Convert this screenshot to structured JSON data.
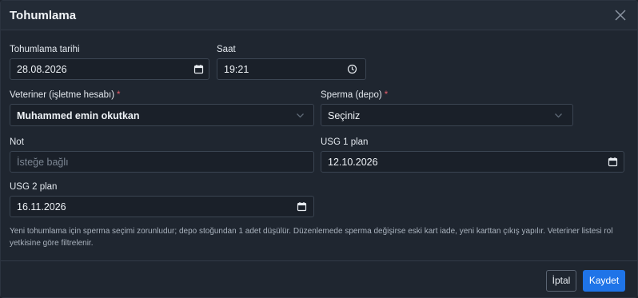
{
  "modal": {
    "title": "Tohumlama"
  },
  "form": {
    "insemination_date": {
      "label": "Tohumlama tarihi",
      "value": "28.08.2026"
    },
    "time": {
      "label": "Saat",
      "value": "19:21"
    },
    "veterinarian": {
      "label": "Veteriner (işletme hesabı)",
      "required_mark": "*",
      "value": "Muhammed emin okutkan"
    },
    "semen": {
      "label": "Sperma (depo)",
      "required_mark": "*",
      "value": "Seçiniz"
    },
    "note": {
      "label": "Not",
      "placeholder": "İsteğe bağlı",
      "value": ""
    },
    "usg1": {
      "label": "USG 1 plan",
      "value": "12.10.2026"
    },
    "usg2": {
      "label": "USG 2 plan",
      "value": "16.11.2026"
    },
    "help_text": "Yeni tohumlama için sperma seçimi zorunludur; depo stoğundan 1 adet düşülür. Düzenlemede sperma değişirse eski kart iade, yeni karttan çıkış yapılır. Veteriner listesi rol yetkisine göre filtrelenir."
  },
  "footer": {
    "cancel_label": "İptal",
    "save_label": "Kaydet"
  },
  "icons": {
    "close": "close-icon",
    "calendar": "calendar-icon",
    "clock": "clock-icon",
    "dropdown": "chevron-down-icon"
  },
  "colors": {
    "background": "#1f2630",
    "accent": "#1f74e8",
    "required": "#e35d6a"
  }
}
